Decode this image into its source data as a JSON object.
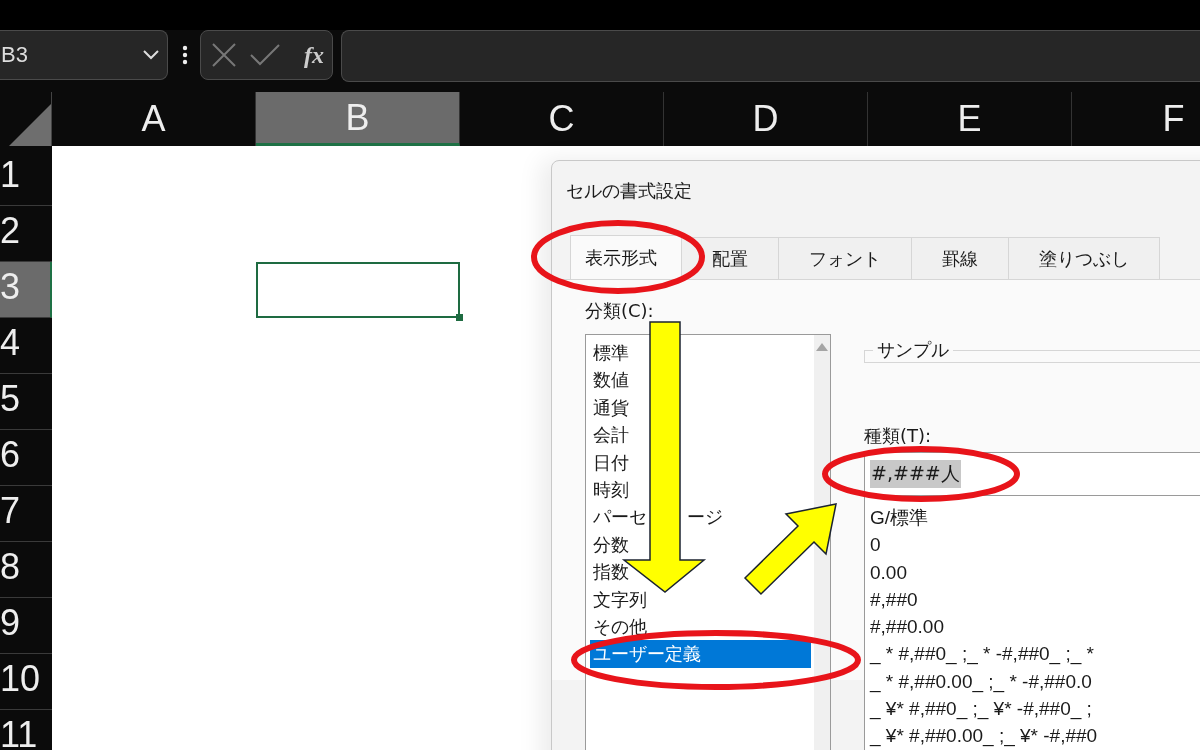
{
  "name_box": {
    "value": "B3"
  },
  "formula_bar": {
    "function_label": "fx"
  },
  "columns": [
    {
      "label": "A",
      "selected": false
    },
    {
      "label": "B",
      "selected": true
    },
    {
      "label": "C",
      "selected": false
    },
    {
      "label": "D",
      "selected": false
    },
    {
      "label": "E",
      "selected": false
    },
    {
      "label": "F",
      "selected": false
    }
  ],
  "rows": [
    {
      "label": "1",
      "selected": false
    },
    {
      "label": "2",
      "selected": false
    },
    {
      "label": "3",
      "selected": true
    },
    {
      "label": "4",
      "selected": false
    },
    {
      "label": "5",
      "selected": false
    },
    {
      "label": "6",
      "selected": false
    },
    {
      "label": "7",
      "selected": false
    },
    {
      "label": "8",
      "selected": false
    },
    {
      "label": "9",
      "selected": false
    },
    {
      "label": "10",
      "selected": false
    },
    {
      "label": "11",
      "selected": false
    }
  ],
  "dialog": {
    "title": "セルの書式設定",
    "tabs": [
      {
        "label": "表示形式",
        "selected": true,
        "circled": true
      },
      {
        "label": "配置",
        "selected": false,
        "circled": false
      },
      {
        "label": "フォント",
        "selected": false,
        "circled": false
      },
      {
        "label": "罫線",
        "selected": false,
        "circled": false
      },
      {
        "label": "塗りつぶし",
        "selected": false,
        "circled": false
      }
    ],
    "category_label": "分類(C):",
    "categories": [
      {
        "label": "標準",
        "selected": false,
        "circled": false
      },
      {
        "label": "数値",
        "selected": false,
        "circled": false
      },
      {
        "label": "通貨",
        "selected": false,
        "circled": false
      },
      {
        "label": "会計",
        "selected": false,
        "circled": false
      },
      {
        "label": "日付",
        "selected": false,
        "circled": false
      },
      {
        "label": "時刻",
        "selected": false,
        "circled": false
      },
      {
        "label": "パーセ",
        "label_end": "ージ",
        "selected": false,
        "circled": false
      },
      {
        "label": "分数",
        "selected": false,
        "circled": false
      },
      {
        "label": "指数",
        "selected": false,
        "circled": false
      },
      {
        "label": "文字列",
        "selected": false,
        "circled": false
      },
      {
        "label": "その他",
        "selected": false,
        "circled": false
      },
      {
        "label": "ユーザー定義",
        "selected": true,
        "circled": true
      }
    ],
    "sample_label": "サンプル",
    "type_label": "種類(T):",
    "type_field": {
      "value": "#,###人",
      "text_selected": true,
      "circled": true
    },
    "formats": [
      "G/標準",
      "0",
      "0.00",
      "#,##0",
      "#,##0.00",
      "_ * #,##0_ ;_ * -#,##0_ ;_ *",
      "_ * #,##0.00_ ;_ * -#,##0.0",
      "_ ¥* #,##0_ ;_ ¥* -#,##0_ ;",
      "_ ¥* #,##0.00_ ;_ ¥* -#,##0"
    ]
  },
  "arrows": [
    {
      "kind": "down"
    },
    {
      "kind": "diagonal"
    }
  ]
}
